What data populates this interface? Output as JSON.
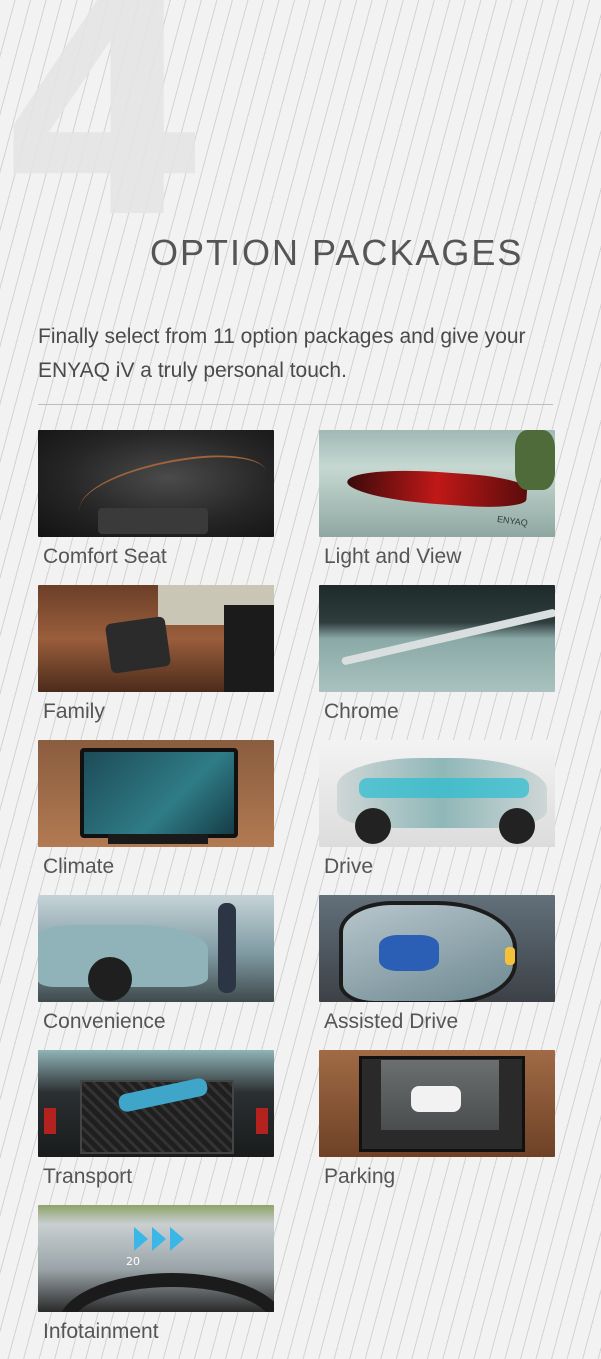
{
  "section_number": "4",
  "title": "OPTION PACKAGES",
  "intro": "Finally select from 11 option packages and give your ENYAQ iV a truly personal touch.",
  "packages": [
    {
      "label": "Comfort Seat"
    },
    {
      "label": "Light and View"
    },
    {
      "label": "Family"
    },
    {
      "label": "Chrome"
    },
    {
      "label": "Climate"
    },
    {
      "label": "Drive"
    },
    {
      "label": "Convenience"
    },
    {
      "label": "Assisted Drive"
    },
    {
      "label": "Transport"
    },
    {
      "label": "Parking"
    },
    {
      "label": "Infotainment"
    }
  ],
  "thumb_texts": {
    "enyaq_badge": "ENYAQ",
    "hud_speed": "20"
  }
}
